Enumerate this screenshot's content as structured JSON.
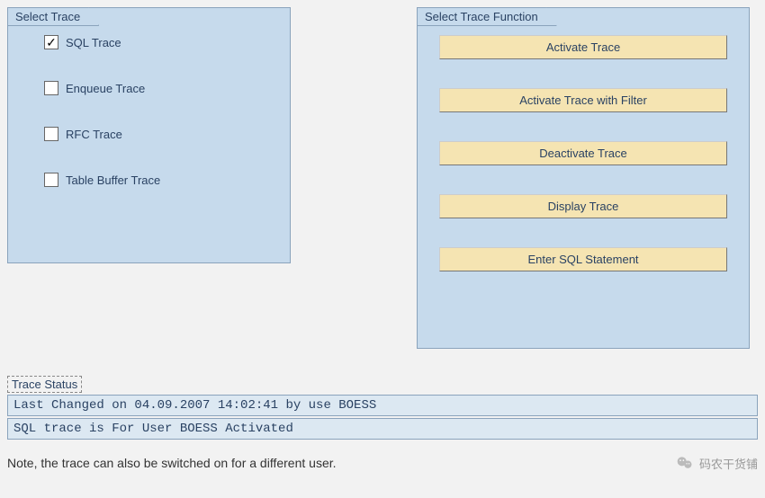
{
  "selectTrace": {
    "title": "Select Trace",
    "options": [
      {
        "label": "SQL Trace",
        "checked": true
      },
      {
        "label": "Enqueue Trace",
        "checked": false
      },
      {
        "label": "RFC Trace",
        "checked": false
      },
      {
        "label": "Table Buffer Trace",
        "checked": false
      }
    ]
  },
  "selectFunction": {
    "title": "Select Trace Function",
    "buttons": [
      "Activate Trace",
      "Activate Trace with Filter",
      "Deactivate Trace",
      "Display Trace",
      "Enter SQL Statement"
    ]
  },
  "status": {
    "title": "Trace Status",
    "line1": "Last Changed on 04.09.2007 14:02:41 by use BOESS",
    "line2": "SQL trace     is For User BOESS Activated"
  },
  "note": "Note, the trace can also be switched on for a different user.",
  "watermark": "码农干货铺"
}
